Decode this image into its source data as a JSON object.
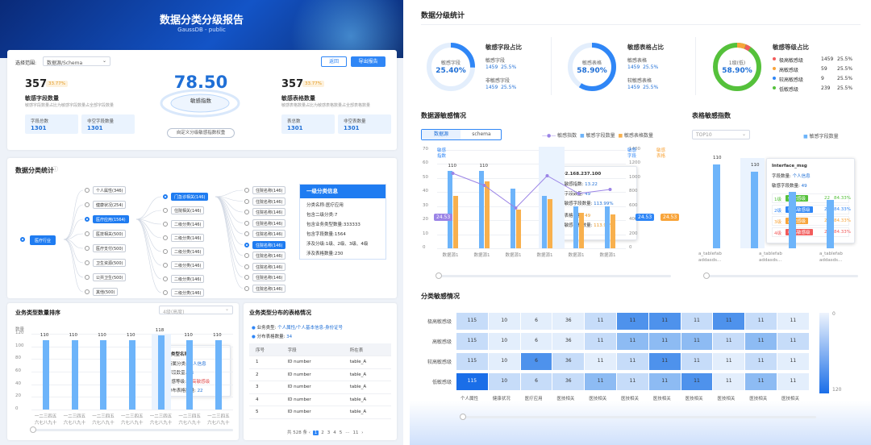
{
  "hero": {
    "title": "数据分类分级报告",
    "subtitle": "GaussDB - public"
  },
  "filter": {
    "label": "选择范围:",
    "value": "数据源/Schema",
    "back": "返回",
    "export": "导出报告"
  },
  "left_stat": {
    "num": "357",
    "pct": "33.77%",
    "title": "敏感字段数量",
    "desc": "敏感字段数量占比为敏感字段数量占全部字段数量",
    "b1l": "字段总数",
    "b1v": "1301",
    "b2l": "非空字段数量",
    "b2v": "1301"
  },
  "center_stat": {
    "num": "78.50",
    "label": "敏感指数",
    "btn": "自定义分级敏感指数权重"
  },
  "right_stat": {
    "num": "357",
    "pct": "33.77%",
    "title": "敏感表格数量",
    "desc": "敏感表格数量占比为敏感表格数量占全部表格数量",
    "b1l": "表总数",
    "b1v": "1301",
    "b2l": "非空表数量",
    "b2v": "1301"
  },
  "tree": {
    "title": "数据分类统计",
    "root": "医疗行业",
    "l1": [
      "个人属性(346)",
      "健康状况(254)",
      "医疗应用(1564)",
      "医技相关(500)",
      "医疗支付(500)",
      "卫生资源(500)",
      "公共卫生(500)",
      "其他(500)"
    ],
    "l2": [
      "门急诊相关(146)",
      "住院相关(146)",
      "二级分类(146)",
      "二级分类(146)",
      "二级分类(146)",
      "二级分类(146)",
      "二级分类(146)",
      "二级分类(146)"
    ],
    "l3": [
      "住院名称(146)",
      "住院名称(146)",
      "住院名称(146)",
      "住院名称(146)",
      "住院名称(146)",
      "住院名称(146)",
      "住院名称(146)",
      "住院名称(146)",
      "住院名称(146)",
      "住院名称(146)"
    ]
  },
  "info": {
    "head": "一级分类信息",
    "rows": [
      "分类名称:医疗应用",
      "包含二级分类:7",
      "包含业务类型数量:333333",
      "包含字段数量:1564",
      "涉及分级:1级、2级、3级、4级",
      "涉及表格数量:230"
    ]
  },
  "bizrank": {
    "title": "业务类型数量排序",
    "select": "4级(高度)",
    "ylabel": "数量",
    "ticks": [
      "120",
      "100",
      "80",
      "60",
      "40",
      "20",
      "0"
    ],
    "values": [
      110,
      110,
      110,
      110,
      118,
      110,
      110
    ],
    "labels": [
      "一二三四五",
      "六七八九十"
    ],
    "tip": {
      "head": "业务类型名称",
      "r1": "所属分类:",
      "v1": "个人信息",
      "r2": "字段数量:",
      "v2": "48",
      "r3": "敏感等级:",
      "v3": "较高敏感级",
      "r4": "分布表格数量:",
      "v4": "22"
    }
  },
  "dist": {
    "title": "业务类型分布的表格情况",
    "bl1": "业务类型:",
    "bv1": "个人属性/个人基本信息-身份证号",
    "bl2": "分布表格数量:",
    "bv2": "34",
    "cols": [
      "序号",
      "字段",
      "所在表"
    ],
    "rows": [
      [
        "1",
        "ID number",
        "table_A"
      ],
      [
        "2",
        "ID number",
        "table_A"
      ],
      [
        "3",
        "ID number",
        "table_A"
      ],
      [
        "4",
        "ID number",
        "table_A"
      ],
      [
        "5",
        "ID number",
        "table_A"
      ]
    ],
    "total": "共 528 条",
    "pages": [
      "1",
      "2",
      "3",
      "4",
      "5",
      "···",
      "11"
    ]
  },
  "grading": {
    "title": "数据分级统计",
    "c1": {
      "title": "敏感字段占比",
      "ring": "敏感字段",
      "pct": "25.40%",
      "l1": "敏感字段",
      "v1": "1459",
      "p1": "25.5%",
      "l2": "非敏感字段",
      "v2": "1459",
      "p2": "25.5%"
    },
    "c2": {
      "title": "敏感表格占比",
      "ring": "敏感表格",
      "pct": "58.90%",
      "l1": "敏感表格",
      "v1": "1459",
      "p1": "25.5%",
      "l2": "较敏感表格",
      "v2": "1459",
      "p2": "25.5%"
    },
    "c3": {
      "title": "敏感等级占比",
      "ring": "1级(低)",
      "pct": "58.90%",
      "items": [
        {
          "name": "极高敏感级",
          "v": "1459",
          "p": "25.5%",
          "color": "#f25c5c"
        },
        {
          "name": "高敏感级",
          "v": "59",
          "p": "25.5%",
          "color": "#f8a43a"
        },
        {
          "name": "较高敏感级",
          "v": "9",
          "p": "25.5%",
          "color": "#2f86f6"
        },
        {
          "name": "低敏感级",
          "v": "239",
          "p": "25.5%",
          "color": "#55c13b"
        }
      ]
    }
  },
  "dssens": {
    "title": "数据源敏感情况",
    "tabs": [
      "数据源",
      "schema"
    ],
    "legend": [
      "敏感指数",
      "敏感字段数量",
      "敏感表格数量"
    ],
    "lyl": [
      "敏感",
      "指数"
    ],
    "ryl": [
      "敏感",
      "字段"
    ],
    "ry2": [
      "敏感",
      "表格"
    ],
    "ly": [
      "70",
      "60",
      "50",
      "40",
      "30",
      "20",
      "10",
      "0"
    ],
    "ry": [
      "1400",
      "1200",
      "1000",
      "800",
      "600",
      "400",
      "200",
      "0"
    ],
    "cats": [
      "数据源1",
      "数据源1",
      "数据源1",
      "数据源1",
      "数据源1",
      "数据源1"
    ],
    "bval": [
      "110",
      "110"
    ],
    "tag1": "24.53",
    "tag2": "24.53",
    "tag3": "24.53",
    "tip": {
      "ip": "192.168.237.100",
      "a": "敏感指数:",
      "av": "13.22",
      "b": "字段数量:",
      "bv": "49",
      "c": "敏感字段数量:",
      "cv": "113.99%",
      "d": "表格数量:",
      "dv": "49",
      "e": "敏感表格数量:",
      "ev": "113.99%"
    }
  },
  "tblidx": {
    "title": "表格敏感指数",
    "select": "TOP10",
    "legend": "敏感字段数量",
    "vals": [
      "110",
      "110"
    ],
    "cats": [
      "a_tablefab",
      "addasds...",
      "a_tablefab",
      "addasds...",
      "a_tablefab",
      "addasds..."
    ],
    "tip": {
      "head": "Interface_msg",
      "r1": "字段数量:",
      "v1": "个人信息",
      "r2": "敏感字段数量:",
      "v2": "49",
      "rows": [
        {
          "lv": "1级",
          "tag": "低敏感级",
          "n": "22",
          "p": "84.33%",
          "c": "#55c13b"
        },
        {
          "lv": "2级",
          "tag": "较高敏感级",
          "n": "22",
          "p": "84.33%",
          "c": "#2f86f6"
        },
        {
          "lv": "3级",
          "tag": "高敏感级",
          "n": "2",
          "p": "84.33%",
          "c": "#f8a43a"
        },
        {
          "lv": "4级",
          "tag": "极高敏感级",
          "n": "22",
          "p": "84.33%",
          "c": "#f25c5c"
        }
      ]
    }
  },
  "heat": {
    "title": "分类敏感情况",
    "rows": [
      "极高敏感级",
      "高敏感级",
      "较高敏感级",
      "低敏感级"
    ],
    "cols": [
      "个人属性",
      "健康状况",
      "医疗应用",
      "医技相关",
      "医技相关",
      "医技相关",
      "医技相关",
      "医技相关",
      "医技相关",
      "医技相关",
      "医技相关"
    ],
    "vals": [
      [
        "115",
        "10",
        "6",
        "36",
        "11",
        "11",
        "11",
        "11",
        "11",
        "11",
        "11"
      ],
      [
        "115",
        "10",
        "6",
        "36",
        "11",
        "11",
        "11",
        "11",
        "11",
        "11",
        "11"
      ],
      [
        "115",
        "10",
        "6",
        "36",
        "11",
        "11",
        "11",
        "11",
        "11",
        "11",
        "11"
      ],
      [
        "115",
        "10",
        "6",
        "36",
        "11",
        "11",
        "11",
        "11",
        "11",
        "11",
        "11"
      ]
    ],
    "shades": [
      [
        2,
        1,
        1,
        1,
        2,
        4,
        4,
        2,
        4,
        2,
        1
      ],
      [
        2,
        1,
        1,
        1,
        2,
        3,
        3,
        3,
        2,
        3,
        2
      ],
      [
        2,
        1,
        4,
        2,
        1,
        2,
        4,
        2,
        1,
        2,
        1
      ],
      [
        6,
        2,
        2,
        2,
        3,
        2,
        3,
        4,
        1,
        3,
        1
      ]
    ],
    "scale_top": "0",
    "scale_bot": "120"
  }
}
